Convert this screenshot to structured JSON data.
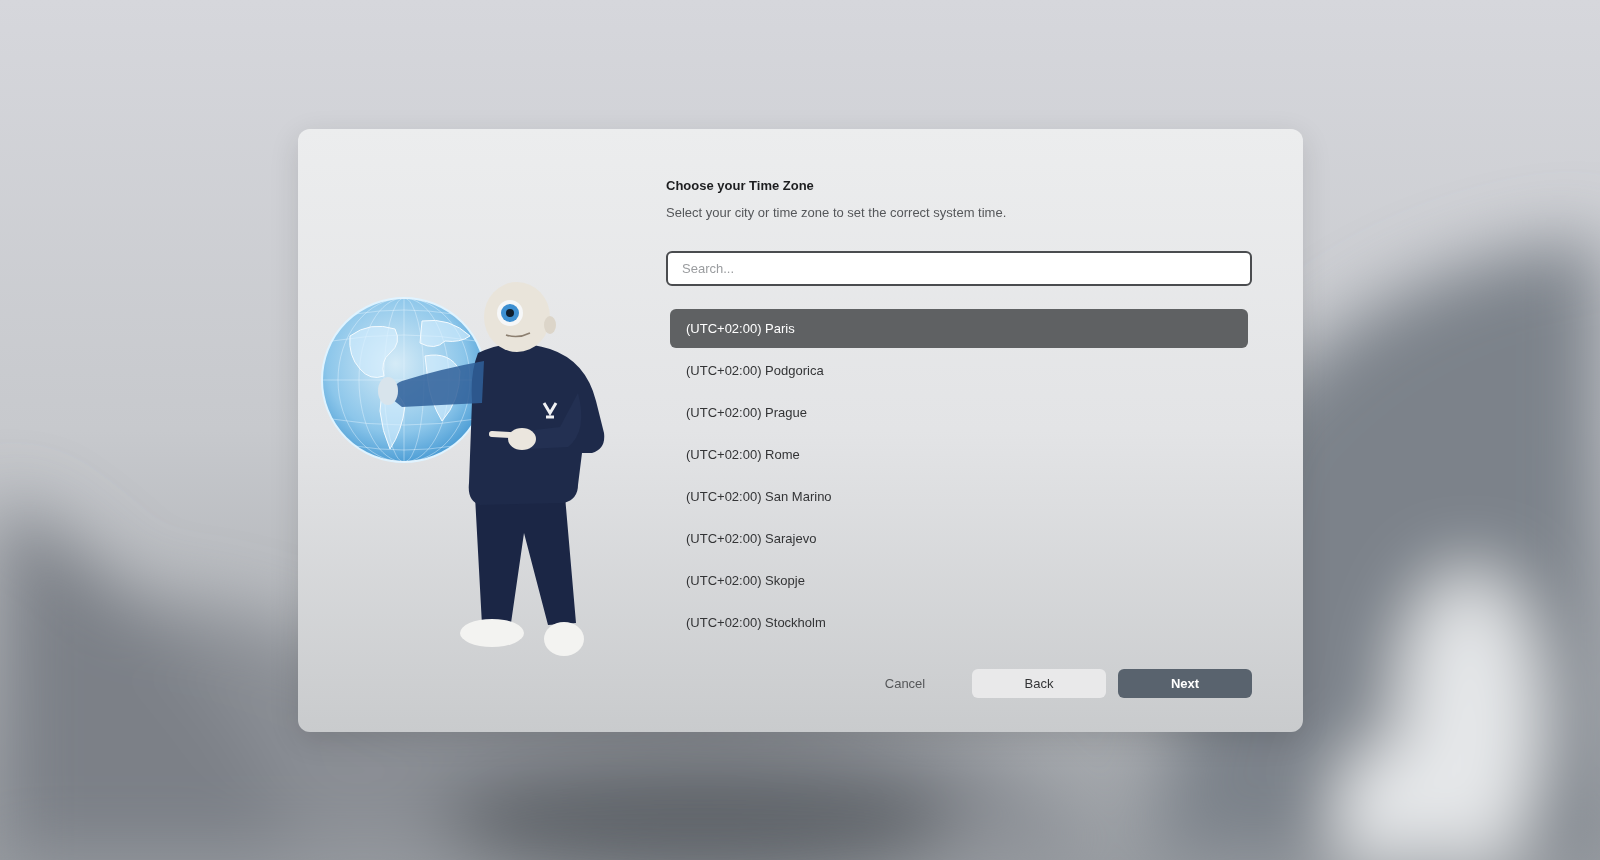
{
  "dialog": {
    "title": "Choose your Time Zone",
    "subtitle": "Select your city or time zone to set the correct system time.",
    "search": {
      "placeholder": "Search...",
      "focused": true
    },
    "time_zones": [
      {
        "label": "(UTC+02:00) Paris",
        "selected": true
      },
      {
        "label": "(UTC+02:00) Podgorica",
        "selected": false
      },
      {
        "label": "(UTC+02:00) Prague",
        "selected": false
      },
      {
        "label": "(UTC+02:00) Rome",
        "selected": false
      },
      {
        "label": "(UTC+02:00) San Marino",
        "selected": false
      },
      {
        "label": "(UTC+02:00) Sarajevo",
        "selected": false
      },
      {
        "label": "(UTC+02:00) Skopje",
        "selected": false
      },
      {
        "label": "(UTC+02:00) Stockholm",
        "selected": false
      }
    ],
    "buttons": [
      {
        "label": "Cancel",
        "kind": "text"
      },
      {
        "label": "Back",
        "kind": "secondary"
      },
      {
        "label": "Next",
        "kind": "primary"
      }
    ]
  }
}
